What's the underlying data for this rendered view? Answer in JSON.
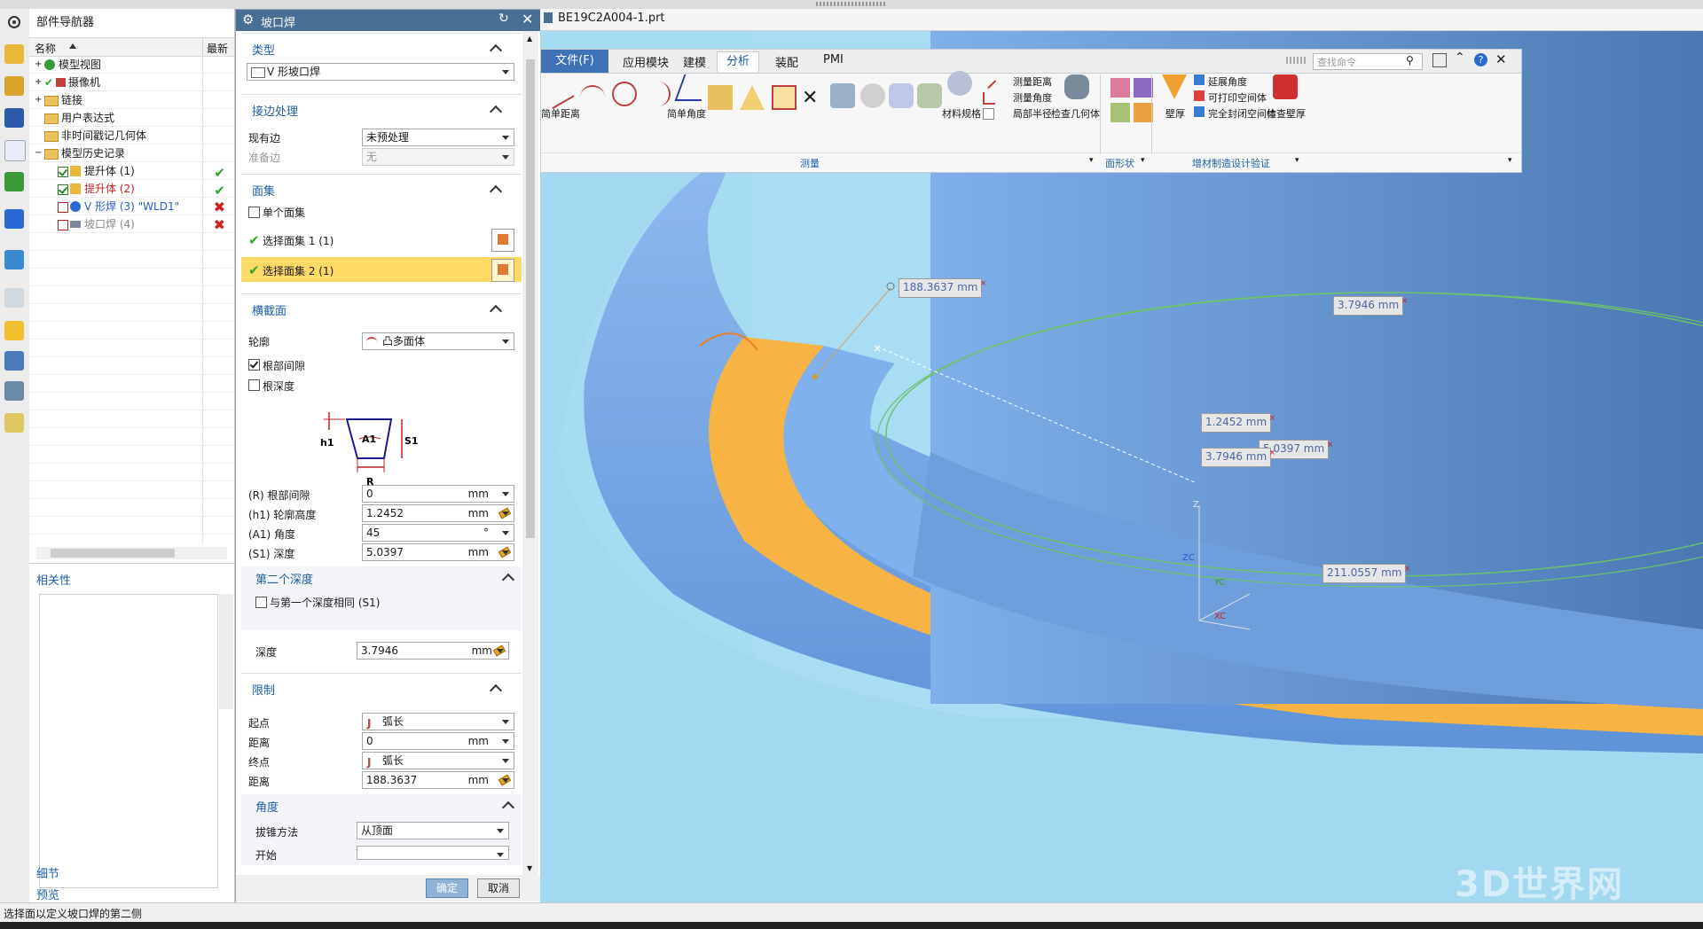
{
  "navigator": {
    "title": "部件导航器",
    "col_name": "名称",
    "col_latest": "最新",
    "items": [
      {
        "label": "模型视图"
      },
      {
        "label": "摄像机"
      },
      {
        "label": "链接"
      },
      {
        "label": "用户表达式"
      },
      {
        "label": "非时间戳记几何体"
      },
      {
        "label": "模型历史记录"
      },
      {
        "label": "提升体 (1)"
      },
      {
        "label": "提升体 (2)"
      },
      {
        "label": "V 形焊 (3) \"WLD1\""
      },
      {
        "label": "坡口焊 (4)"
      }
    ],
    "dependency_title": "相关性",
    "detail_title": "细节",
    "preview_title": "预览"
  },
  "dialog": {
    "title": "坡口焊",
    "type_header": "类型",
    "type_value": "V 形坡口焊",
    "edge_header": "接边处理",
    "existing_edge_label": "现有边",
    "existing_edge_value": "未预处理",
    "prep_edge_label": "准备边",
    "prep_edge_value": "无",
    "faceset_header": "面集",
    "single_faceset_label": "单个面集",
    "select_faceset1": "选择面集 1 (1)",
    "select_faceset2": "选择面集 2 (1)",
    "cross_header": "横截面",
    "profile_label": "轮廓",
    "profile_value": "凸多面体",
    "root_gap_label": "根部间隙",
    "root_depth_label": "根深度",
    "diagram": {
      "h1": "h1",
      "a1": "A1",
      "s1": "S1",
      "r": "R"
    },
    "r_label": "(R) 根部间隙",
    "r_value": "0",
    "h1_label": "(h1) 轮廓高度",
    "h1_value": "1.2452",
    "a1_label": "(A1) 角度",
    "a1_value": "45",
    "s1_label": "(S1) 深度",
    "s1_value": "5.0397",
    "unit_mm": "mm",
    "unit_deg": "°",
    "second_depth_header": "第二个深度",
    "same_as_first_label": "与第一个深度相同 (S1)",
    "depth_label": "深度",
    "depth_value": "3.7946",
    "limit_header": "限制",
    "start_label": "起点",
    "start_value": "弧长",
    "dist1_label": "距离",
    "dist1_value": "0",
    "end_label": "终点",
    "end_value": "弧长",
    "dist2_label": "距离",
    "dist2_value": "188.3637",
    "angle_header": "角度",
    "draft_label": "拔锥方法",
    "draft_value": "从顶面",
    "start_angle_label": "开始",
    "ok_label": "确定",
    "cancel_label": "取消"
  },
  "viewport": {
    "file_tab": "BE19C2A004-1.prt",
    "measures": [
      "188.3637 mm",
      "3.7946 mm",
      "1.2452 mm",
      "5.0397 mm",
      "3.7946 mm",
      "211.0557 mm"
    ],
    "axes": {
      "z": "Z",
      "zc": "ZC",
      "yc": "YC",
      "xc": "XC"
    }
  },
  "ribbon": {
    "tabs": [
      "文件(F)",
      "应用模块",
      "建模",
      "分析",
      "装配",
      "PMI"
    ],
    "active_tab": "分析",
    "search_placeholder": "查找命令",
    "tools": {
      "simple_distance": "简单距离",
      "simple_angle": "简单角度",
      "material": "材料规格",
      "measure_distance": "测量距离",
      "measure_angle": "测量角度",
      "local_radius": "局部半径",
      "check_geometry": "检查几何体",
      "wall": "壁厚",
      "overhang": "延展角度",
      "printable": "可打印空间体",
      "closed": "完全封闭空间体",
      "check_wall": "检查壁厚"
    },
    "groups": {
      "measure": "测量",
      "shape": "面形状",
      "am": "增材制造设计验证"
    }
  },
  "status": {
    "text": "选择面以定义坡口焊的第二侧"
  },
  "watermark": "3D世界网",
  "colors": {
    "title_blue": "#4a6f94",
    "ribbon_file": "#3d72b4",
    "sky": "#9ad6f0",
    "orange": "#f7b445"
  }
}
